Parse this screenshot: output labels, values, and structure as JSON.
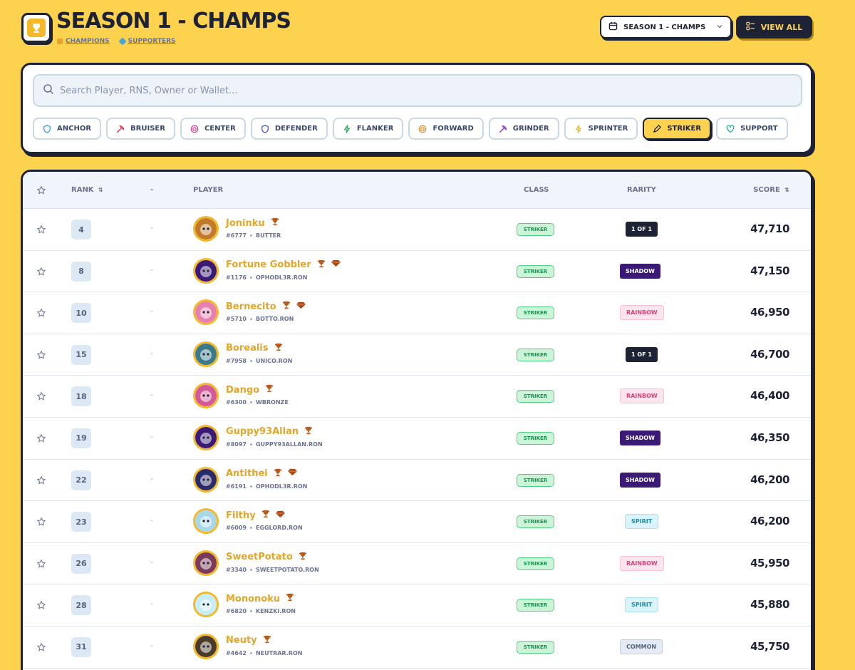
{
  "header": {
    "title": "SEASON 1 - CHAMPS",
    "links": [
      {
        "label": "CHAMPIONS",
        "icon": "medal-icon",
        "color": "#e3a62a"
      },
      {
        "label": "SUPPORTERS",
        "icon": "gem-icon",
        "color": "#4aa8d8"
      }
    ],
    "season_select": "SEASON 1 - CHAMPS",
    "view_all": "VIEW ALL"
  },
  "search": {
    "placeholder": "Search Player, RNS, Owner or Wallet...",
    "value": ""
  },
  "classes": [
    {
      "label": "ANCHOR",
      "icon": "shield-icon",
      "color": "#3aa0d8",
      "active": false
    },
    {
      "label": "BRUISER",
      "icon": "hammer-icon",
      "color": "#e04a5c",
      "active": false
    },
    {
      "label": "CENTER",
      "icon": "target-icon",
      "color": "#d8458f",
      "active": false
    },
    {
      "label": "DEFENDER",
      "icon": "shield-icon",
      "color": "#4a56c8",
      "active": false
    },
    {
      "label": "FLANKER",
      "icon": "bolt-icon",
      "color": "#27a85c",
      "active": false
    },
    {
      "label": "FORWARD",
      "icon": "target-icon",
      "color": "#e58a2a",
      "active": false
    },
    {
      "label": "GRINDER",
      "icon": "hammer-icon",
      "color": "#9a4ac8",
      "active": false
    },
    {
      "label": "SPRINTER",
      "icon": "bolt-icon",
      "color": "#e3b42a",
      "active": false
    },
    {
      "label": "STRIKER",
      "icon": "pencil-icon",
      "color": "#27a85c",
      "active": true
    },
    {
      "label": "SUPPORT",
      "icon": "heart-icon",
      "color": "#27a89a",
      "active": false
    }
  ],
  "table": {
    "columns": {
      "rank": "RANK",
      "change": "-",
      "player": "PLAYER",
      "class": "CLASS",
      "rarity": "RARITY",
      "score": "SCORE"
    },
    "rows": [
      {
        "rank": "4",
        "change": "-",
        "name": "Joninku",
        "id": "#6777",
        "owner": "BUTTER",
        "gem": false,
        "class": "STRIKER",
        "rarity": "1 OF 1",
        "rarity_key": "1of1",
        "score": "47,710",
        "avatar": "#c07a2a"
      },
      {
        "rank": "8",
        "change": "-",
        "name": "Fortune Gobbler",
        "id": "#1176",
        "owner": "OPHODL3R.RON",
        "gem": true,
        "class": "STRIKER",
        "rarity": "SHADOW",
        "rarity_key": "shadow",
        "score": "47,150",
        "avatar": "#3a1a75"
      },
      {
        "rank": "10",
        "change": "-",
        "name": "Bernecito",
        "id": "#5710",
        "owner": "BOTTO.RON",
        "gem": true,
        "class": "STRIKER",
        "rarity": "RAINBOW",
        "rarity_key": "rainbow",
        "score": "46,950",
        "avatar": "#e680b0"
      },
      {
        "rank": "15",
        "change": "-",
        "name": "Borealis",
        "id": "#7958",
        "owner": "UNICO.RON",
        "gem": false,
        "class": "STRIKER",
        "rarity": "1 OF 1",
        "rarity_key": "1of1",
        "score": "46,700",
        "avatar": "#3a7a8a"
      },
      {
        "rank": "18",
        "change": "-",
        "name": "Dango",
        "id": "#6300",
        "owner": "WBRONZE",
        "gem": false,
        "class": "STRIKER",
        "rarity": "RAINBOW",
        "rarity_key": "rainbow",
        "score": "46,400",
        "avatar": "#d35a9a"
      },
      {
        "rank": "19",
        "change": "-",
        "name": "Guppy93Allan",
        "id": "#8097",
        "owner": "GUPPY93ALLAN.RON",
        "gem": false,
        "class": "STRIKER",
        "rarity": "SHADOW",
        "rarity_key": "shadow",
        "score": "46,350",
        "avatar": "#3a1a75"
      },
      {
        "rank": "22",
        "change": "-",
        "name": "Antithei",
        "id": "#6191",
        "owner": "OPHODL3R.RON",
        "gem": true,
        "class": "STRIKER",
        "rarity": "SHADOW",
        "rarity_key": "shadow",
        "score": "46,200",
        "avatar": "#2a2a6a"
      },
      {
        "rank": "23",
        "change": "-",
        "name": "Filthy",
        "id": "#6009",
        "owner": "EGGLORD.RON",
        "gem": true,
        "class": "STRIKER",
        "rarity": "SPIRIT",
        "rarity_key": "spirit",
        "score": "46,200",
        "avatar": "#a8d8e8"
      },
      {
        "rank": "26",
        "change": "-",
        "name": "SweetPotato",
        "id": "#3340",
        "owner": "SWEETPOTATO.RON",
        "gem": false,
        "class": "STRIKER",
        "rarity": "RAINBOW",
        "rarity_key": "rainbow",
        "score": "45,950",
        "avatar": "#7a3a5a"
      },
      {
        "rank": "28",
        "change": "-",
        "name": "Mononoku",
        "id": "#6820",
        "owner": "KENZKI.RON",
        "gem": false,
        "class": "STRIKER",
        "rarity": "SPIRIT",
        "rarity_key": "spirit",
        "score": "45,880",
        "avatar": "#c8eef5"
      },
      {
        "rank": "31",
        "change": "-",
        "name": "Neuty",
        "id": "#4642",
        "owner": "NEUTRAR.RON",
        "gem": false,
        "class": "STRIKER",
        "rarity": "COMMON",
        "rarity_key": "common",
        "score": "45,750",
        "avatar": "#4a3a2a"
      }
    ]
  }
}
